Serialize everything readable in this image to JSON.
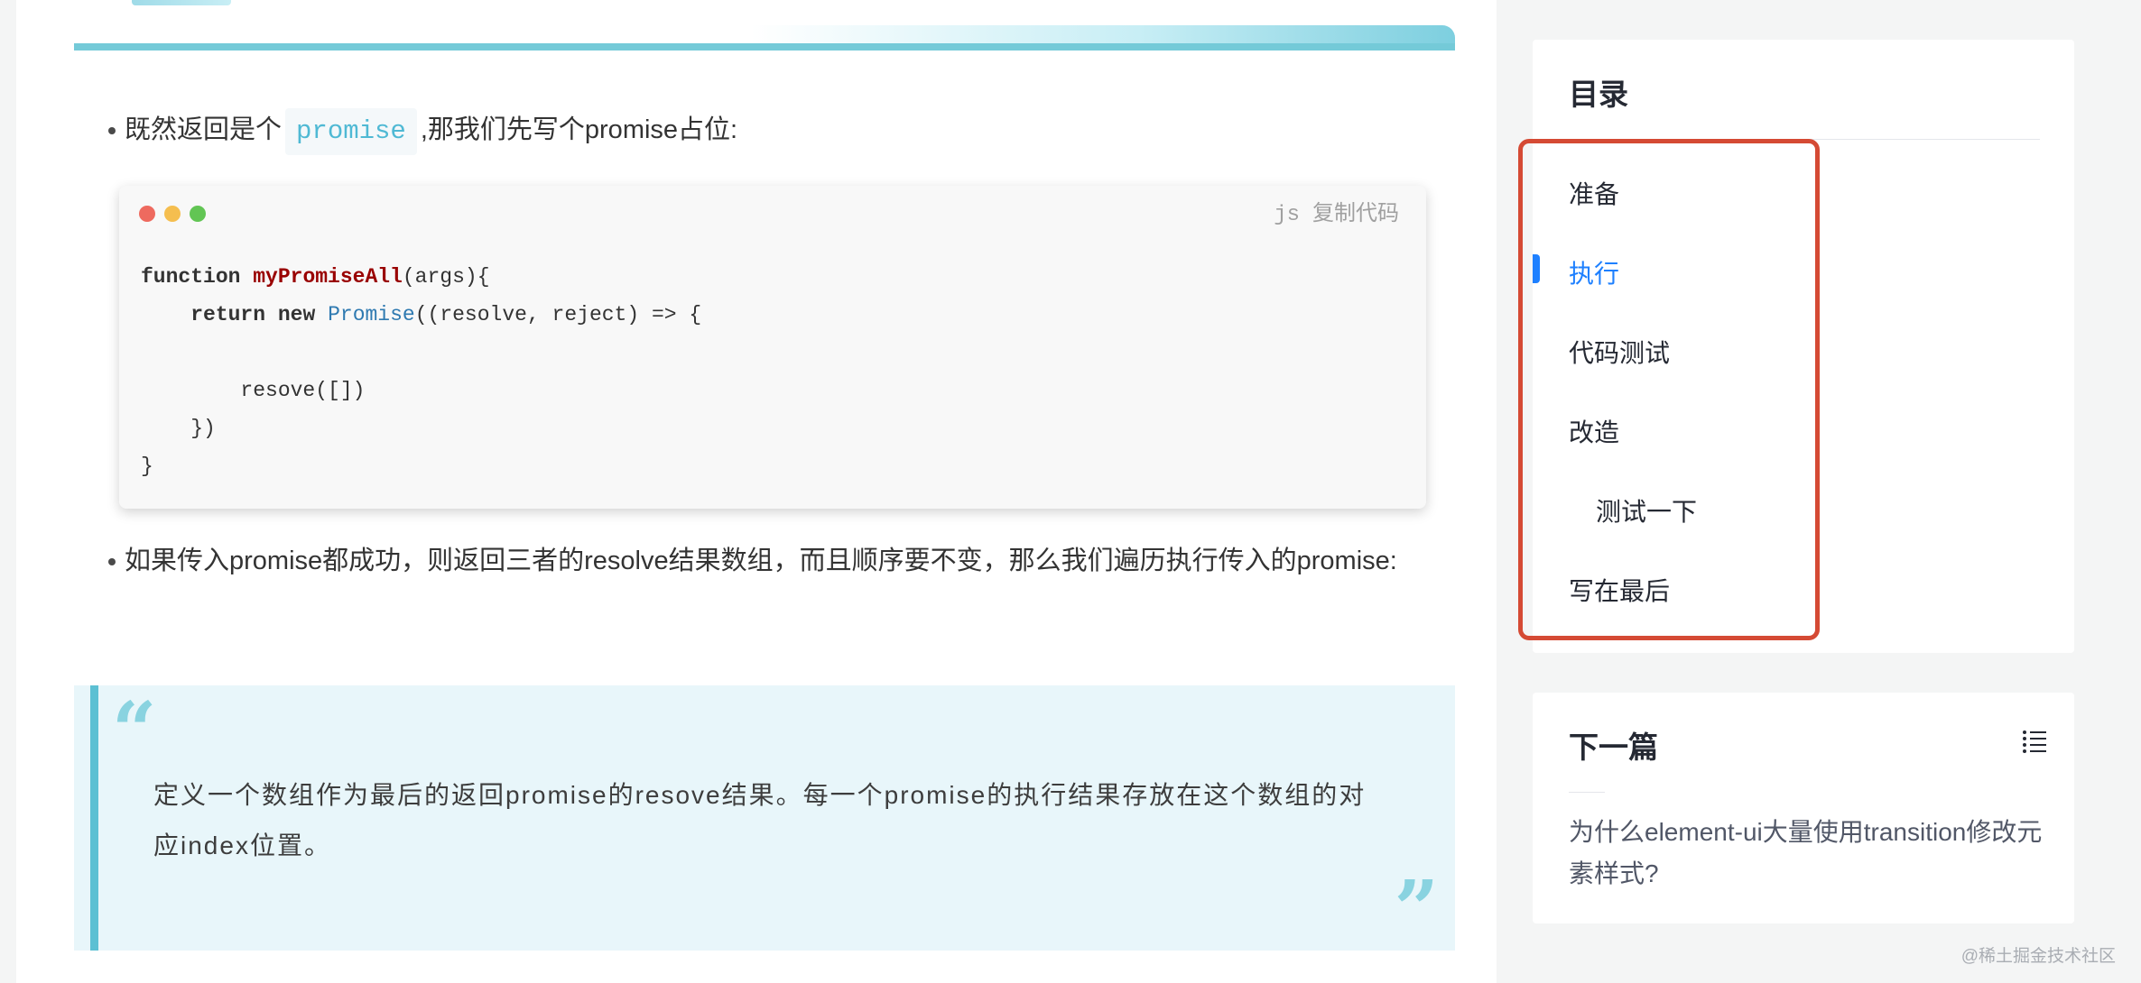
{
  "article": {
    "bullet1": {
      "before": "既然返回是个",
      "code": "promise",
      "after": ",那我们先写个promise占位:"
    },
    "code_block": {
      "lang": "js",
      "copy_label": "复制代码",
      "lines": [
        "function myPromiseAll(args){",
        "    return new Promise((resolve, reject) => {",
        "",
        "        resove([])",
        "    })",
        "}"
      ]
    },
    "bullet2": "如果传入promise都成功，则返回三者的resolve结果数组，而且顺序要不变，那么我们遍历执行传入的promise:",
    "quote": "定义一个数组作为最后的返回promise的resove结果。每一个promise的执行结果存放在这个数组的对应index位置。"
  },
  "toc": {
    "title": "目录",
    "items": [
      {
        "label": "准备",
        "active": false,
        "level": 1
      },
      {
        "label": "执行",
        "active": true,
        "level": 1
      },
      {
        "label": "代码测试",
        "active": false,
        "level": 1
      },
      {
        "label": "改造",
        "active": false,
        "level": 1
      },
      {
        "label": "测试一下",
        "active": false,
        "level": 2
      },
      {
        "label": "写在最后",
        "active": false,
        "level": 1
      }
    ]
  },
  "next": {
    "title": "下一篇",
    "link": "为什么element-ui大量使用transition修改元素样式?"
  },
  "watermark": "@稀土掘金技术社区",
  "colors": {
    "accent": "#1e80ff",
    "highlight_border": "#d54a34",
    "heading_underline": "#74cad8",
    "quote_background": "#e8f6fa"
  }
}
